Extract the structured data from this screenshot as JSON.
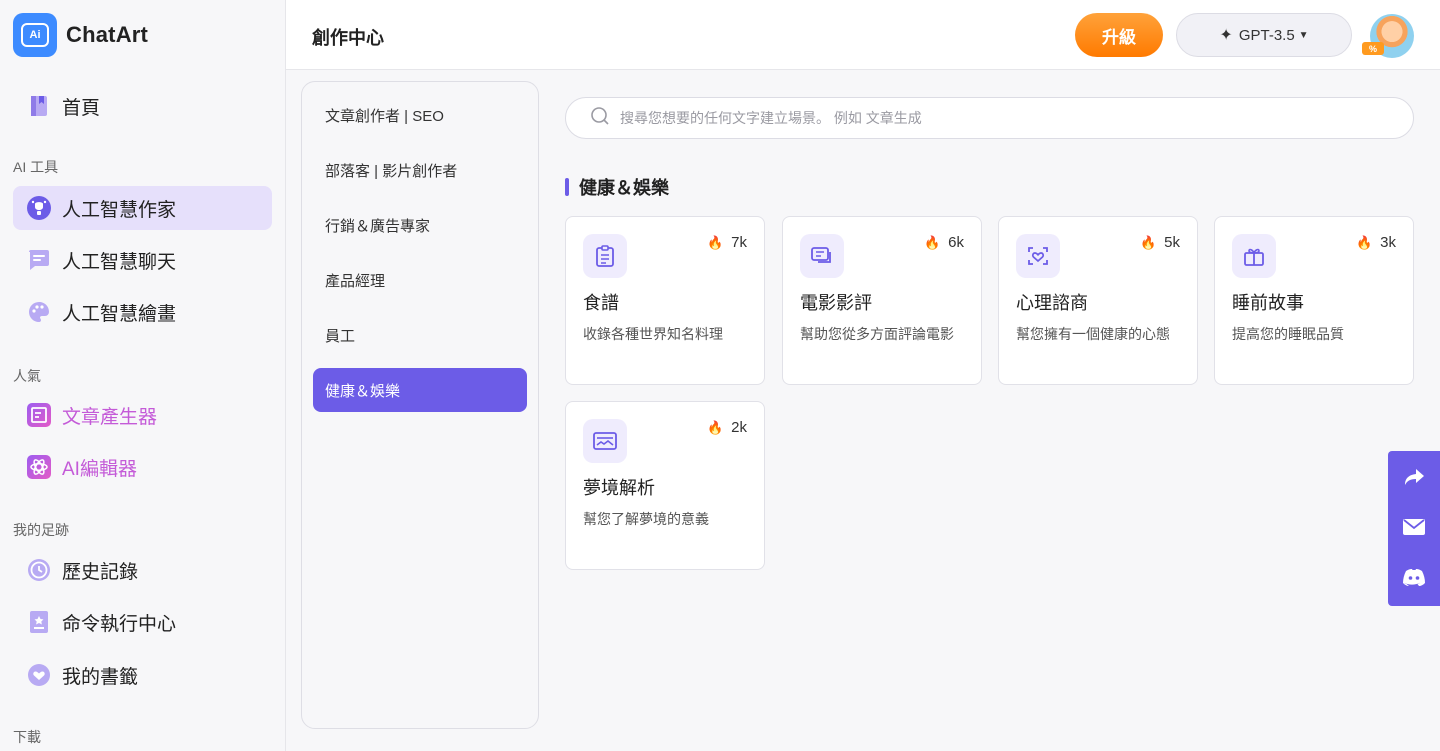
{
  "app": {
    "name": "ChatArt",
    "logo_text": "Ai"
  },
  "sidebar": {
    "home": "首頁",
    "sections": {
      "ai_tools": "AI 工具",
      "popular": "人氣",
      "footprint": "我的足跡",
      "download": "下載"
    },
    "ai_tools": [
      {
        "label": "人工智慧作家",
        "icon": "ai-writer-icon",
        "active": true
      },
      {
        "label": "人工智慧聊天",
        "icon": "chat-icon"
      },
      {
        "label": "人工智慧繪畫",
        "icon": "palette-icon"
      }
    ],
    "popular": [
      {
        "label": "文章產生器",
        "icon": "article-generator-icon"
      },
      {
        "label": "AI編輯器",
        "icon": "ai-editor-icon"
      }
    ],
    "footprint": [
      {
        "label": "歷史記錄",
        "icon": "history-icon"
      },
      {
        "label": "命令執行中心",
        "icon": "command-center-icon"
      },
      {
        "label": "我的書籤",
        "icon": "bookmark-icon"
      }
    ]
  },
  "header": {
    "title": "創作中心",
    "upgrade_label": "升級",
    "model_label": "GPT-3.5",
    "avatar_badge": "%"
  },
  "categories": [
    {
      "label": "文章創作者 | SEO"
    },
    {
      "label": "部落客 | 影片創作者"
    },
    {
      "label": "行銷＆廣告專家"
    },
    {
      "label": "產品經理"
    },
    {
      "label": "員工"
    },
    {
      "label": "健康＆娛樂",
      "active": true
    }
  ],
  "search": {
    "placeholder": "搜尋您想要的任何文字建立場景。 例如 文章生成"
  },
  "section_title": "健康＆娛樂",
  "cards": [
    {
      "title": "食譜",
      "desc": "收錄各種世界知名料理",
      "hot": "7k",
      "icon": "recipe-clipboard-icon"
    },
    {
      "title": "電影影評",
      "desc": "幫助您從多方面評論電影",
      "hot": "6k",
      "icon": "movie-review-icon"
    },
    {
      "title": "心理諮商",
      "desc": "幫您擁有一個健康的心態",
      "hot": "5k",
      "icon": "heart-consult-icon"
    },
    {
      "title": "睡前故事",
      "desc": "提高您的睡眠品質",
      "hot": "3k",
      "icon": "story-book-icon"
    },
    {
      "title": "夢境解析",
      "desc": "幫您了解夢境的意義",
      "hot": "2k",
      "icon": "dream-icon"
    }
  ],
  "float_bar": [
    {
      "icon": "share-icon"
    },
    {
      "icon": "mail-icon"
    },
    {
      "icon": "discord-icon"
    }
  ],
  "colors": {
    "accent": "#6c5ce7",
    "upgrade": "#ff8a12",
    "active_bg": "#e6e0fb",
    "pink": "#c45bd8"
  }
}
